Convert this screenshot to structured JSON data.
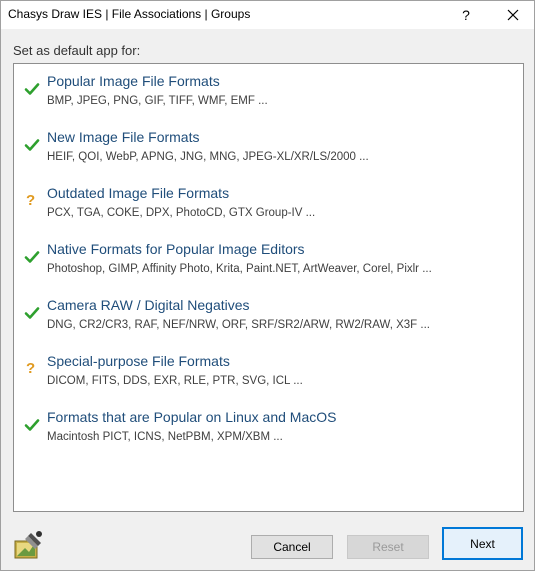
{
  "window": {
    "title": "Chasys Draw IES | File Associations | Groups",
    "help_label": "?",
    "close_icon": "close-icon"
  },
  "prompt": "Set as default app for:",
  "colors": {
    "check": "#2ea02e",
    "question": "#e09a20",
    "group_title": "#1f4d7a",
    "accent": "#0078d7"
  },
  "groups": [
    {
      "name": "Popular Image File Formats",
      "extensions": "BMP, JPEG, PNG, GIF, TIFF, WMF, EMF ...",
      "status": "checked"
    },
    {
      "name": "New Image File Formats",
      "extensions": "HEIF, QOI, WebP, APNG, JNG, MNG, JPEG-XL/XR/LS/2000 ...",
      "status": "checked"
    },
    {
      "name": "Outdated Image File Formats",
      "extensions": "PCX, TGA, COKE, DPX, PhotoCD, GTX Group-IV ...",
      "status": "question"
    },
    {
      "name": "Native Formats for Popular Image Editors",
      "extensions": "Photoshop, GIMP, Affinity Photo, Krita, Paint.NET, ArtWeaver, Corel, Pixlr ...",
      "status": "checked"
    },
    {
      "name": "Camera RAW / Digital Negatives",
      "extensions": "DNG, CR2/CR3, RAF, NEF/NRW, ORF, SRF/SR2/ARW, RW2/RAW, X3F ...",
      "status": "checked"
    },
    {
      "name": "Special-purpose File Formats",
      "extensions": "DICOM, FITS, DDS, EXR, RLE, PTR, SVG, ICL ...",
      "status": "question"
    },
    {
      "name": "Formats that are Popular on Linux and MacOS",
      "extensions": "Macintosh PICT, ICNS, NetPBM, XPM/XBM ...",
      "status": "checked"
    }
  ],
  "buttons": {
    "cancel": "Cancel",
    "reset": "Reset",
    "next": "Next"
  }
}
